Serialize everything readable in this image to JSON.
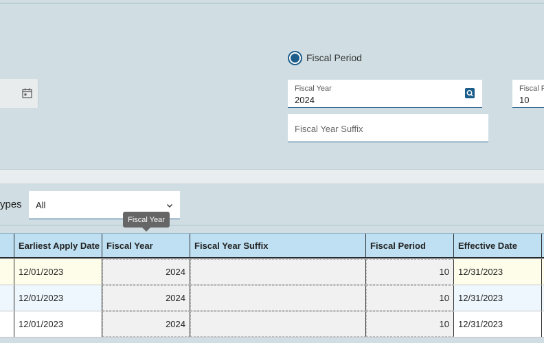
{
  "period_selector": {
    "radio_label": "Fiscal Period",
    "selected": true
  },
  "fiscal_year": {
    "label": "Fiscal Year",
    "value": "2024"
  },
  "fiscal_period": {
    "label": "Fiscal P",
    "value": "10"
  },
  "fiscal_year_suffix": {
    "placeholder": "Fiscal Year Suffix"
  },
  "filter": {
    "label": "ypes",
    "value": "All"
  },
  "tooltip": {
    "text": "Fiscal Year"
  },
  "grid": {
    "columns": [
      "Earliest Apply Date",
      "Fiscal Year",
      "Fiscal Year Suffix",
      "Fiscal Period",
      "Effective Date"
    ],
    "rows": [
      {
        "earliest_apply_date": "12/01/2023",
        "fiscal_year": "2024",
        "fiscal_year_suffix": "",
        "fiscal_period": "10",
        "effective_date": "12/31/2023",
        "bg": "#fdfdea"
      },
      {
        "earliest_apply_date": "12/01/2023",
        "fiscal_year": "2024",
        "fiscal_year_suffix": "",
        "fiscal_period": "10",
        "effective_date": "12/31/2023",
        "bg": "#eef7fd"
      },
      {
        "earliest_apply_date": "12/01/2023",
        "fiscal_year": "2024",
        "fiscal_year_suffix": "",
        "fiscal_period": "10",
        "effective_date": "12/31/2023",
        "bg": "#ffffff"
      }
    ]
  },
  "icons": {
    "date_picker": "calendar-icon",
    "lookup": "search-lookup-icon",
    "dropdown": "chevron-down-icon"
  },
  "colors": {
    "accent": "#1d5d8a",
    "header_bg": "#bfe0f2",
    "panel_bg": "#d0dee3"
  }
}
